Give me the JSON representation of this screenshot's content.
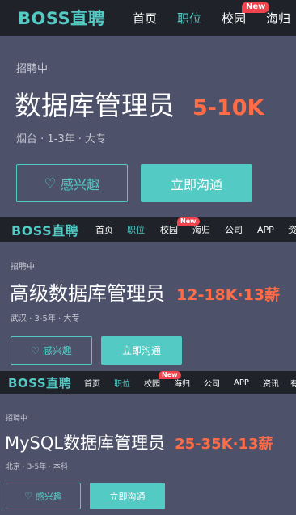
{
  "screens": [
    {
      "nav": {
        "logo": "BOSS直聘",
        "items": [
          "首页",
          "职位",
          "校园",
          "海归"
        ],
        "active_index": 1,
        "badge": "New"
      },
      "status": "招聘中",
      "job_title": "数据库管理员",
      "salary": "5-10K",
      "meta": "烟台 · 1-3年 · 大专",
      "interest_label": "感兴趣",
      "contact_label": "立即沟通"
    },
    {
      "nav": {
        "logo": "BOSS直聘",
        "items": [
          "首页",
          "职位",
          "校园",
          "海归",
          "公司",
          "APP",
          "资"
        ],
        "active_index": 1,
        "badge": "New"
      },
      "status": "招聘中",
      "job_title": "高级数据库管理员",
      "salary": "12-18K·13薪",
      "meta": "武汉 · 3-5年 · 大专",
      "interest_label": "感兴趣",
      "contact_label": "立即沟通"
    },
    {
      "nav": {
        "logo": "BOSS直聘",
        "items": [
          "首页",
          "职位",
          "校园",
          "海归",
          "公司",
          "APP",
          "资讯",
          "有"
        ],
        "active_index": 1,
        "badge": "New"
      },
      "status": "招聘中",
      "job_title": "MySQL数据库管理员",
      "salary": "25-35K·13薪",
      "meta": "北京 · 3-5年 · 本科",
      "interest_label": "感兴趣",
      "contact_label": "立即沟通"
    }
  ],
  "colors": {
    "brand": "#53cac3",
    "nav_bg": "#1f2229",
    "page_bg": "#4d526a",
    "salary": "#ff6c48",
    "badge": "#f0454f"
  },
  "icons": {
    "interest": "heart-outline-icon"
  }
}
